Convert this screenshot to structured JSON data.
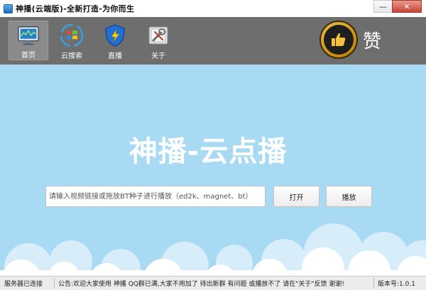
{
  "window": {
    "title": "神播(云端版)-全新打造-为你而生",
    "minimize_label": "—",
    "close_label": "✕"
  },
  "toolbar": {
    "items": [
      {
        "label": "首页",
        "icon": "monitor-icon",
        "active": true
      },
      {
        "label": "云搜索",
        "icon": "windows-logo-icon",
        "active": false
      },
      {
        "label": "直播",
        "icon": "shield-icon",
        "active": false
      },
      {
        "label": "关于",
        "icon": "tools-icon",
        "active": false
      }
    ],
    "like_label": "赞",
    "like_icon": "thumbs-up-icon"
  },
  "main": {
    "title": "神播-云点播",
    "search_placeholder": "请输入视频链接或拖放BT种子进行播放（ed2k、magnet、bt）",
    "open_button": "打开",
    "play_button": "播放"
  },
  "statusbar": {
    "connection": "服务器已连接",
    "notice": "公告:欢迎大家使用 神播 QQ群已满,大家不用加了 待出新群  有问题 或播放不了 请在\"关于\"反馈  谢谢!",
    "version": "版本号:1.0.1"
  },
  "colors": {
    "toolbar_bg": "#6e6e6e",
    "main_bg": "#a8daf4",
    "title_text": "#ffffff"
  }
}
